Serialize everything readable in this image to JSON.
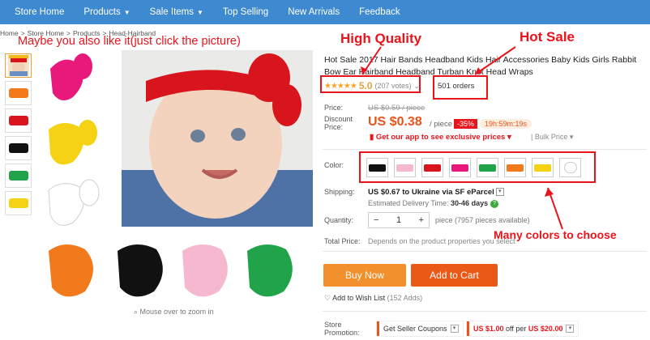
{
  "nav": {
    "items": [
      {
        "label": "Store Home",
        "caret": false
      },
      {
        "label": "Products",
        "caret": true
      },
      {
        "label": "Sale Items",
        "caret": true
      },
      {
        "label": "Top Selling",
        "caret": false
      },
      {
        "label": "New Arrivals",
        "caret": false
      },
      {
        "label": "Feedback",
        "caret": false
      }
    ]
  },
  "breadcrumb": [
    "Home",
    ">",
    "Store Home",
    ">",
    "Products",
    ">",
    "Head-Hairband"
  ],
  "annotations": {
    "like": "Maybe you also like it(just click the picture)",
    "high_quality": "High Quality",
    "hot_sale": "Hot Sale",
    "many_colors": "Many colors to choose"
  },
  "product": {
    "title": "Hot Sale 2017 Hair Bands Headband Kids Hair Accessories Baby Kids Girls Rabbit Bow Ear Hairband Headband Turban Knot Head Wraps",
    "stars": "★★★★★",
    "score": "5.0",
    "votes": "(207 votes)",
    "orders": "501 orders",
    "price_label": "Price:",
    "orig_price": "US $0.59 / piece",
    "discount_label": "Discount\nPrice:",
    "price": "US $0.38",
    "per_piece": "/ piece",
    "discount": "-35%",
    "timer": "19h:59m:19s",
    "app_link": "Get our app to see exclusive prices",
    "bulk": "Bulk Price",
    "color_label": "Color:",
    "colors": [
      "#111111",
      "#f5b8cf",
      "#d8141c",
      "#e8197a",
      "#21a34a",
      "#f27a1b",
      "#f5d214",
      "#ffffff"
    ],
    "shipping_label": "Shipping:",
    "shipping": "US $0.67 to Ukraine via SF eParcel",
    "est_label": "Estimated Delivery Time:",
    "est_value": "30-46 days",
    "qty_label": "Quantity:",
    "qty": "1",
    "qty_avail": "piece (7957 pieces available)",
    "total_label": "Total Price:",
    "total_note": "Depends on the product properties you select",
    "buy": "Buy Now",
    "cart": "Add to Cart",
    "wishlist": "Add to Wish List",
    "wishlist_count": "(152 Adds)",
    "store_promo_label": "Store\nPromotion:",
    "coupon1": "Get Seller Coupons",
    "coupon2_a": "US $1.00",
    "coupon2_b": "off per",
    "coupon2_c": "US $20.00"
  },
  "zoom_hint": "Mouse over to zoom in",
  "thumbs": [
    "#e36b8f",
    "#f27a1b",
    "#d8141c",
    "#111111",
    "#21a34a",
    "#f5d214"
  ]
}
